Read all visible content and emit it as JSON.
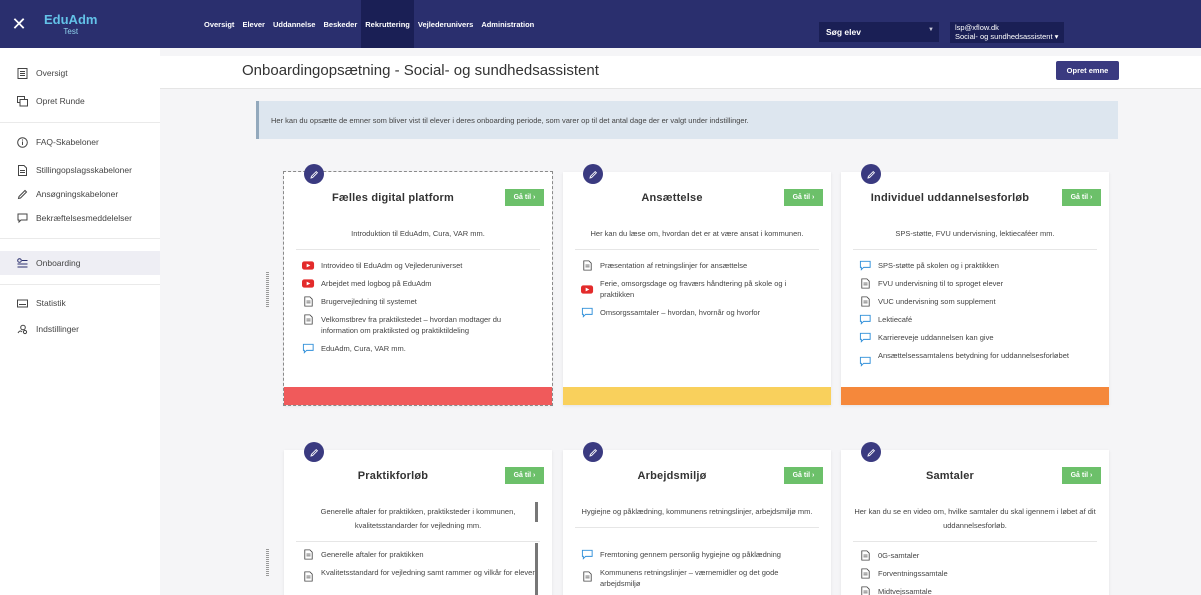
{
  "brand": {
    "close_glyph": "✕",
    "title": "EduAdm",
    "subtitle": "Test"
  },
  "topnav": {
    "tabs": [
      {
        "label": "Oversigt",
        "active": false
      },
      {
        "label": "Elever",
        "active": false
      },
      {
        "label": "Uddannelse",
        "active": false
      },
      {
        "label": "Beskeder",
        "active": false
      },
      {
        "label": "Rekruttering",
        "active": true
      },
      {
        "label": "Vejlederunivers",
        "active": false
      },
      {
        "label": "Administration",
        "active": false
      }
    ],
    "search_label": "Søg elev",
    "user_email": "lsp@xflow.dk",
    "user_role": "Social- og sundhedsassistent ▾"
  },
  "sidebar": {
    "items": [
      {
        "label": "Oversigt",
        "icon": "document-list-icon"
      },
      {
        "label": "Opret Runde",
        "icon": "stack-icon"
      },
      {
        "label": "FAQ-Skabeloner",
        "icon": "info-icon"
      },
      {
        "label": "Stillingopslagsskabeloner",
        "icon": "document-icon"
      },
      {
        "label": "Ansøgningskabeloner",
        "icon": "pencil-icon"
      },
      {
        "label": "Bekræftelsesmeddelelser",
        "icon": "comment-icon"
      },
      {
        "label": "Onboarding",
        "icon": "sliders-icon",
        "active": true
      },
      {
        "label": "Statistik",
        "icon": "keyboard-icon"
      },
      {
        "label": "Indstillinger",
        "icon": "gear-users-icon"
      }
    ]
  },
  "page": {
    "title": "Onboardingopsætning - Social- og sundhedsassistent",
    "create_button": "Opret emne",
    "info_text": "Her kan du opsætte de emner som bliver vist til elever i deres onboarding periode, som varer op til det antal dage der er valgt under indstillinger."
  },
  "colors": {
    "red": "#f05a5b",
    "yellow": "#f9d05c",
    "orange": "#f5883b",
    "go_green": "#6cc06a",
    "navy": "#2a2f6e",
    "button": "#3a3a80"
  },
  "cards": [
    {
      "title": "Fælles digital platform",
      "goto": "Gå til ›",
      "desc": "Introduktion til EduAdm, Cura, VAR  mm.",
      "items": [
        {
          "icon": "youtube-icon",
          "text": "Introvideo til EduAdm og Vejlederuniverset"
        },
        {
          "icon": "youtube-icon",
          "text": "Arbejdet med logbog på EduAdm"
        },
        {
          "icon": "document-icon",
          "text": "Brugervejledning til systemet"
        },
        {
          "icon": "document-icon",
          "text": "Velkomstbrev fra praktikstedet – hvordan modtager du information om praktiksted og praktiktildeling"
        },
        {
          "icon": "comment-icon",
          "text": "EduAdm, Cura, VAR mm."
        }
      ]
    },
    {
      "title": "Ansættelse",
      "goto": "Gå til ›",
      "desc": "Her kan du læse om, hvordan det er at være ansat i kommunen.",
      "items": [
        {
          "icon": "document-icon",
          "text": "Præsentation af retningslinjer for ansættelse"
        },
        {
          "icon": "youtube-icon",
          "text": "Ferie, omsorgsdage og fraværs håndtering på skole og i praktikken"
        },
        {
          "icon": "comment-icon",
          "text": "Omsorgssamtaler – hvordan, hvornår og hvorfor"
        }
      ]
    },
    {
      "title": "Individuel uddannelsesforløb",
      "goto": "Gå til ›",
      "desc": "SPS-støtte, FVU undervisning, lektiecaféer mm.",
      "items": [
        {
          "icon": "comment-icon",
          "text": "SPS-støtte på skolen og i praktikken"
        },
        {
          "icon": "document-icon",
          "text": "FVU undervisning til to sproget elever"
        },
        {
          "icon": "document-icon",
          "text": "VUC undervisning som supplement"
        },
        {
          "icon": "comment-icon",
          "text": "Lektiecafé"
        },
        {
          "icon": "comment-icon",
          "text": "Karriereveje uddannelsen kan give"
        },
        {
          "icon": "comment-icon",
          "text": "Ansættelsessamtalens betydning for uddannelsesforløbet"
        }
      ]
    },
    {
      "title": "Praktikforløb",
      "goto": "Gå til ›",
      "desc": "Generelle aftaler for praktikken, praktiksteder i kommunen, kvalitetsstandarder for vejledning mm.",
      "items": [
        {
          "icon": "document-icon",
          "text": "Generelle aftaler for praktikken"
        },
        {
          "icon": "document-icon",
          "text": "Kvalitetsstandard for vejledning samt rammer og vilkår for elever"
        }
      ]
    },
    {
      "title": "Arbejdsmiljø",
      "goto": "Gå til ›",
      "desc": "Hygiejne og påklædning, kommunens retningslinjer, arbejdsmiljø mm.",
      "items": [
        {
          "icon": "comment-icon",
          "text": "Fremtoning gennem personlig hygiejne og påklædning"
        },
        {
          "icon": "document-icon",
          "text": "Kommunens retningslinjer – værnemidler og det gode arbejdsmiljø"
        }
      ]
    },
    {
      "title": "Samtaler",
      "goto": "Gå til ›",
      "desc": "Her kan du se en video om, hvilke samtaler du skal igennem i løbet af dit uddannelsesforløb.",
      "items": [
        {
          "icon": "document-icon",
          "text": "0G-samtaler"
        },
        {
          "icon": "document-icon",
          "text": "Forventningssamtale"
        },
        {
          "icon": "document-icon",
          "text": "Midtvejssamtale"
        }
      ]
    }
  ]
}
